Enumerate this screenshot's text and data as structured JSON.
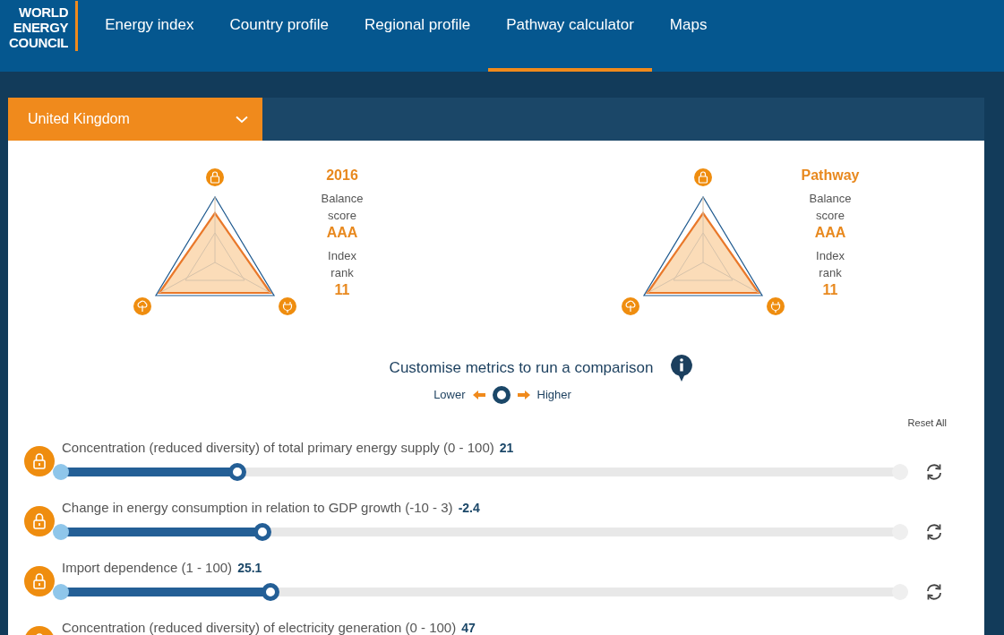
{
  "logo": {
    "lines": [
      "WORLD",
      "ENERGY",
      "COUNCIL"
    ]
  },
  "nav": [
    {
      "label": "Energy index",
      "selected": false
    },
    {
      "label": "Country profile",
      "selected": false
    },
    {
      "label": "Regional profile",
      "selected": false
    },
    {
      "label": "Pathway calculator",
      "selected": true
    },
    {
      "label": "Maps",
      "selected": false
    }
  ],
  "country_select": {
    "value": "United Kingdom"
  },
  "scorecards": [
    {
      "title": "2016",
      "balance_label": "Balance score",
      "balance_score": "AAA",
      "rank_label": "Index rank",
      "rank": "11"
    },
    {
      "title": "Pathway",
      "balance_label": "Balance score",
      "balance_score": "AAA",
      "rank_label": "Index rank",
      "rank": "11"
    }
  ],
  "comparison": {
    "title": "Customise metrics to run a comparison",
    "lower": "Lower",
    "higher": "Higher"
  },
  "reset_all": "Reset All",
  "metrics": [
    {
      "label": "Concentration (reduced diversity) of total primary energy supply (0 - 100)",
      "value": "21",
      "level": 0.21
    },
    {
      "label": "Change in energy consumption in relation to GDP growth (-10 - 3)",
      "value": "-2.4",
      "level": 0.24
    },
    {
      "label": "Import dependence (1 - 100)",
      "value": "25.1",
      "level": 0.25
    },
    {
      "label": "Concentration (reduced diversity) of electricity generation (0 - 100)",
      "value": "47"
    }
  ]
}
